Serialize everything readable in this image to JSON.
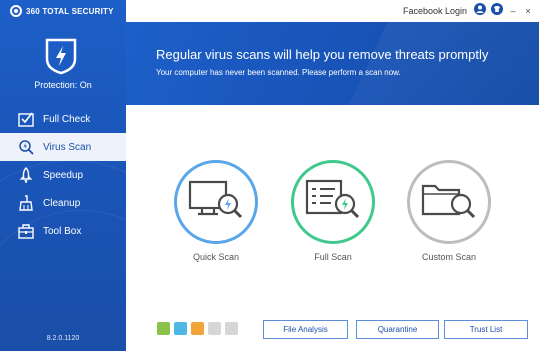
{
  "brand": {
    "name": "360 TOTAL SECURITY"
  },
  "protection": {
    "status": "Protection: On"
  },
  "nav": [
    {
      "label": "Full Check"
    },
    {
      "label": "Virus Scan"
    },
    {
      "label": "Speedup"
    },
    {
      "label": "Cleanup"
    },
    {
      "label": "Tool Box"
    }
  ],
  "version": "8.2.0.1120",
  "topbar": {
    "login": "Facebook Login",
    "minimize": "–",
    "close": "×"
  },
  "banner": {
    "title": "Regular virus scans will help you remove threats promptly",
    "subtitle": "Your computer has never been scanned. Please perform a scan now."
  },
  "scans": {
    "quick": "Quick Scan",
    "full": "Full Scan",
    "custom": "Custom Scan"
  },
  "buttons": {
    "file_analysis": "File Analysis",
    "quarantine": "Quarantine",
    "trust_list": "Trust List"
  },
  "colors": {
    "accent": "#1a4fa9",
    "quick": "#5aa6e8",
    "full": "#3fc98c",
    "custom": "#bdbdbd",
    "tool_green": "#8bc34a",
    "tool_blue": "#4fb7e6",
    "tool_orange": "#f2a33a",
    "tool_gray": "#d6d6d6"
  },
  "icons": [
    "shield-lightning-icon",
    "checklist-icon",
    "magnifier-lightning-icon",
    "rocket-icon",
    "broom-icon",
    "toolbox-icon",
    "monitor-magnifier-icon",
    "document-magnifier-icon",
    "folder-magnifier-icon",
    "user-icon",
    "shirt-icon"
  ]
}
